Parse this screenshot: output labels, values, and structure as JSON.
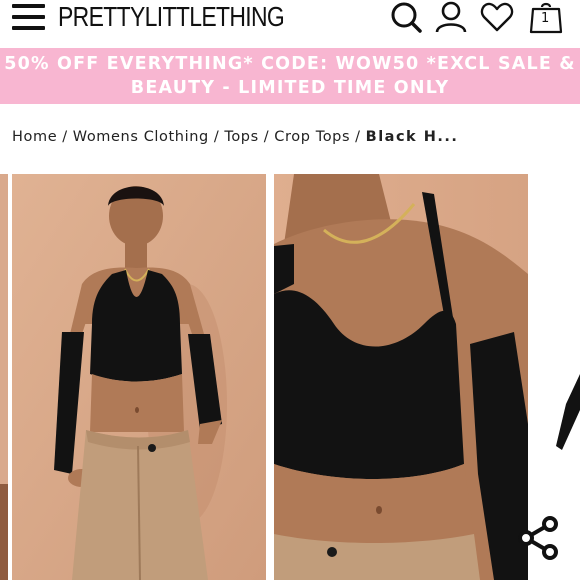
{
  "header": {
    "brand": "PRETTYLITTLETHING",
    "menu_icon": "hamburger-menu-icon",
    "search_icon": "search-icon",
    "account_icon": "user-icon",
    "wishlist_icon": "heart-icon",
    "bag_icon": "shopping-bag-icon",
    "bag_count": "1"
  },
  "promo": {
    "line1": "50% OFF EVERYTHING* CODE: WOW50 *EXCL SALE &",
    "line2": "BEAUTY - LIMITED TIME ONLY",
    "background": "#f8b6d1",
    "text_color": "#ffffff"
  },
  "breadcrumb": {
    "items": [
      "Home",
      "Womens Clothing",
      "Tops",
      "Crop Tops"
    ],
    "current": "Black H...",
    "separator": "/"
  },
  "gallery": {
    "images": [
      "product-image-full-body",
      "product-image-close-up"
    ],
    "share_icon": "share-icon"
  },
  "colors": {
    "backdrop": "#d9a98c",
    "garment": "#111111",
    "skin": "#b07a57"
  }
}
